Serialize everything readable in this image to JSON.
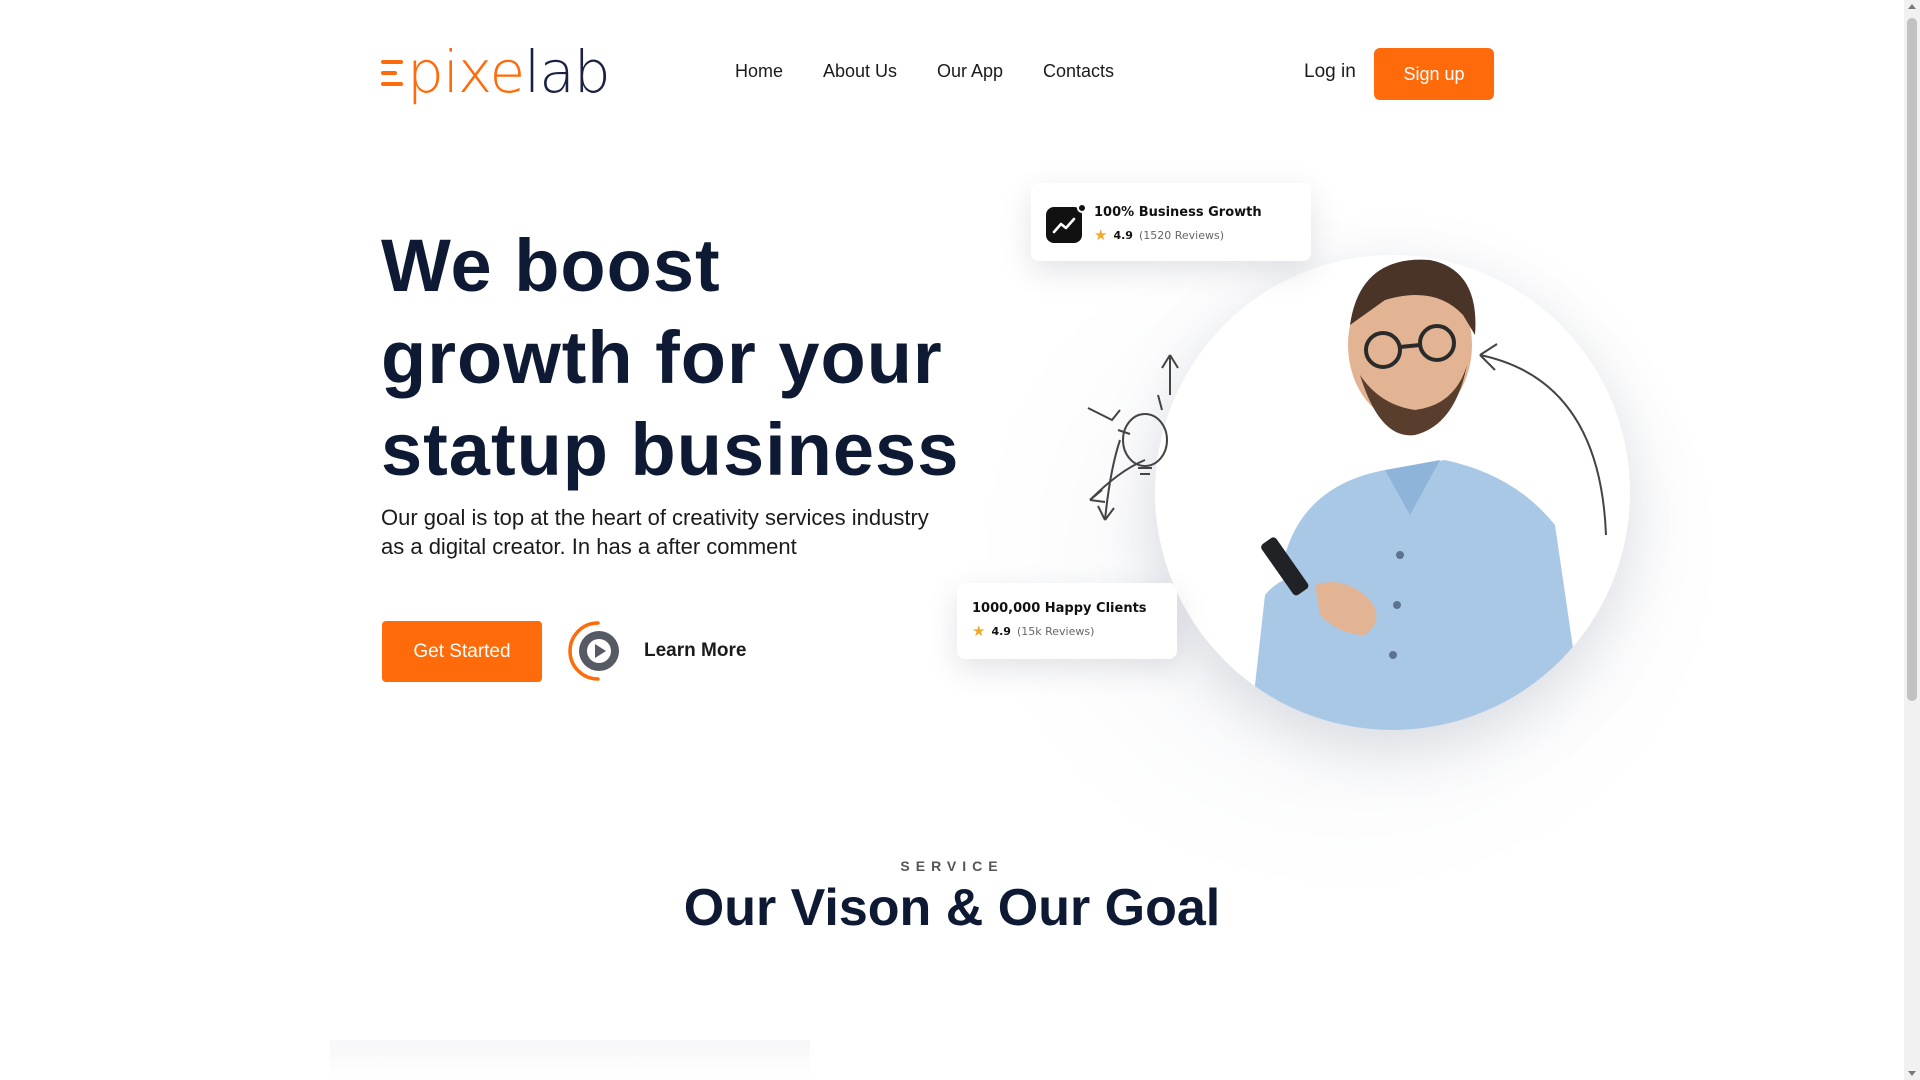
{
  "header": {
    "logo_e": "e",
    "logo_pixe": "pixe",
    "logo_lab": "lab",
    "nav": [
      {
        "label": "Home"
      },
      {
        "label": "About Us"
      },
      {
        "label": "Our App"
      },
      {
        "label": "Contacts"
      }
    ],
    "login_label": "Log in",
    "signup_label": "Sign up"
  },
  "hero": {
    "title_lines": [
      "We boost",
      "growth for your",
      "statup business"
    ],
    "subtitle_lines": [
      "Our goal is top at the heart of creativity services industry",
      "as a digital creator. In has a after comment"
    ],
    "get_started_label": "Get Started",
    "learn_more_label": "Learn More",
    "card_growth": {
      "title": "100% Business Growth",
      "rating": "4.9",
      "reviews": "(1520 Reviews)",
      "icon": "trend-chart-icon"
    },
    "card_clients": {
      "title": "1000,000 Happy Clients",
      "rating": "4.9",
      "reviews": "(15k Reviews)"
    }
  },
  "service": {
    "kicker": "SERVICE",
    "title": "Our Vison & Our Goal"
  },
  "colors": {
    "accent": "#ff6a0b",
    "heading": "#0e1a33",
    "text": "#1b1b1b",
    "star": "#f4a82b"
  }
}
